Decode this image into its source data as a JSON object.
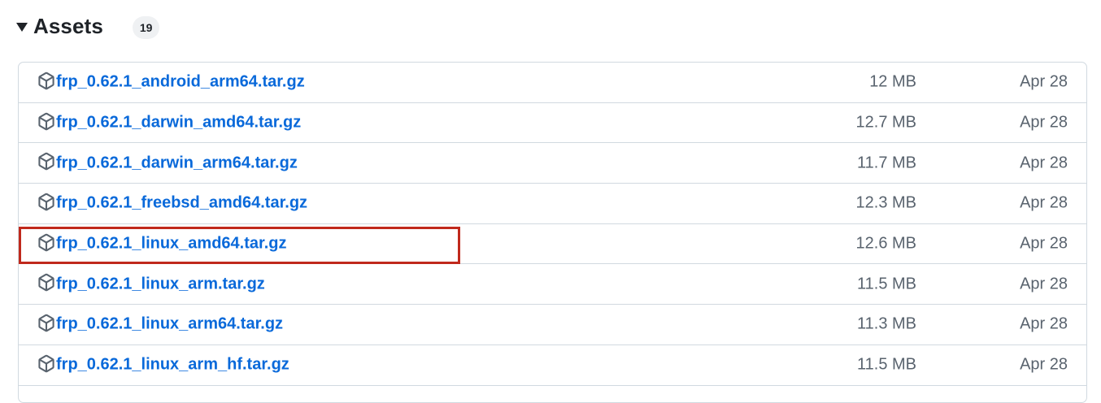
{
  "assets": {
    "title": "Assets",
    "count": "19",
    "items": [
      {
        "name": "frp_0.62.1_android_arm64.tar.gz",
        "size": "12 MB",
        "date": "Apr 28"
      },
      {
        "name": "frp_0.62.1_darwin_amd64.tar.gz",
        "size": "12.7 MB",
        "date": "Apr 28"
      },
      {
        "name": "frp_0.62.1_darwin_arm64.tar.gz",
        "size": "11.7 MB",
        "date": "Apr 28"
      },
      {
        "name": "frp_0.62.1_freebsd_amd64.tar.gz",
        "size": "12.3 MB",
        "date": "Apr 28"
      },
      {
        "name": "frp_0.62.1_linux_amd64.tar.gz",
        "size": "12.6 MB",
        "date": "Apr 28",
        "highlighted": true
      },
      {
        "name": "frp_0.62.1_linux_arm.tar.gz",
        "size": "11.5 MB",
        "date": "Apr 28"
      },
      {
        "name": "frp_0.62.1_linux_arm64.tar.gz",
        "size": "11.3 MB",
        "date": "Apr 28"
      },
      {
        "name": "frp_0.62.1_linux_arm_hf.tar.gz",
        "size": "11.5 MB",
        "date": "Apr 28"
      }
    ]
  },
  "icons": {
    "row_icon": "package-icon",
    "toggle_icon": "triangle-down-icon"
  },
  "colors": {
    "link": "#0969da",
    "muted": "#59636e",
    "border": "#d1d9e0",
    "highlight": "#c0291c"
  }
}
